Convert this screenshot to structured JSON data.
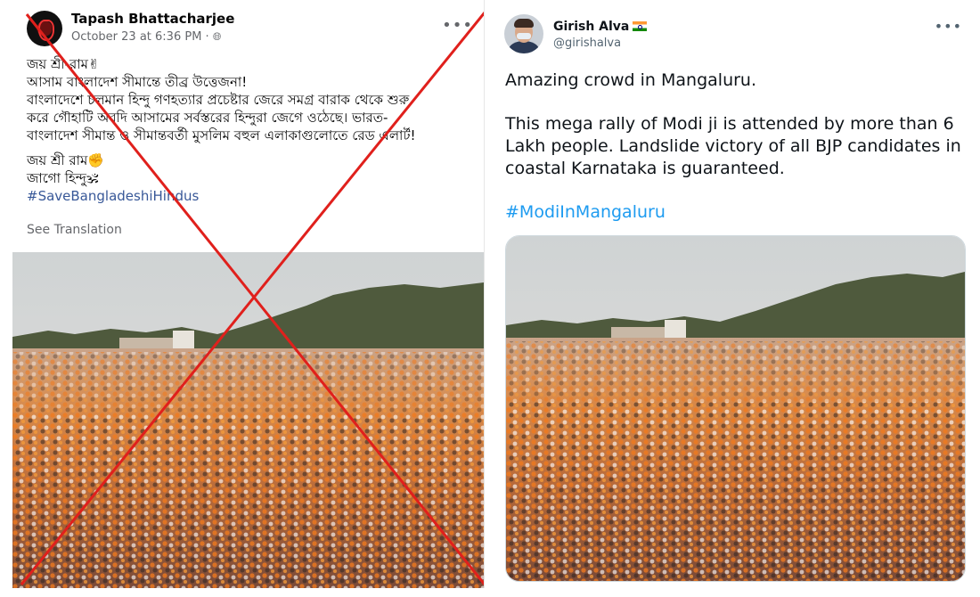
{
  "facebook_post": {
    "author": "Tapash Bhattacharjee",
    "meta": "October 23 at 6:36 PM ·",
    "more_label": "•••",
    "lines": [
      "জয় শ্রী-রাম✌",
      "আসাম বাংলাদেশ সীমান্তে তীব্র উত্তেজনা!",
      "বাংলাদেশে চলমান হিন্দু গণহত্যার প্রচেষ্টার জেরে সমগ্র বারাক থেকে শুরু",
      "করে গৌহাটি অবদি আসামের সর্বস্তরের হিন্দুরা জেগে ওঠেছে। ভারত-",
      "বাংলাদেশ সীমান্ত ও সীমান্তবর্তী মুসলিম বহুল এলাকাগুলোতে রেড এলার্ট!"
    ],
    "lines2": [
      "জয় শ্রী রাম✊",
      "জাগো হিন্দু🕉"
    ],
    "hashtag": "#SaveBangladeshiHindus",
    "see_translation": "See Translation",
    "cross_color": "#e0201c"
  },
  "twitter_post": {
    "author": "Girish Alva",
    "handle": "@girishalva",
    "more_label": "•••",
    "text_line1": "Amazing crowd in Mangaluru.",
    "text_line2": "This mega rally of Modi ji is attended by more than 6 Lakh people. Landslide victory of all BJP candidates in coastal Karnataka is guaranteed.",
    "hashtag": "#ModiInMangaluru",
    "hashtag_color": "#1d9bf0"
  },
  "icons": {
    "globe": "globe-icon",
    "more": "more-options-icon",
    "flag": "india-flag-icon"
  }
}
